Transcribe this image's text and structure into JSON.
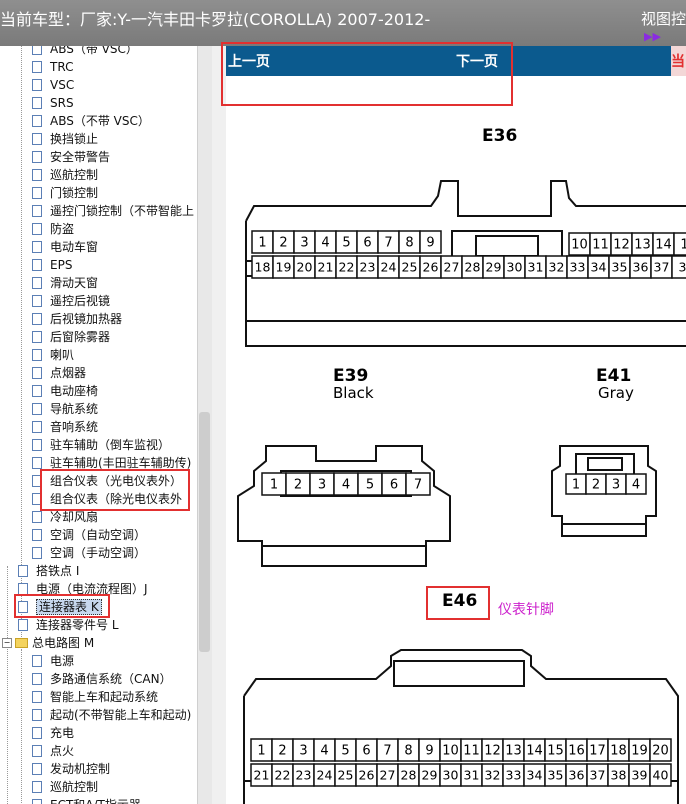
{
  "window": {
    "title": "当前车型：厂家:Y-一汽丰田卡罗拉(COROLLA) 2007-2012-",
    "view_control": "视图控",
    "play_icon": "play-icon"
  },
  "tree": {
    "items": [
      {
        "label": "ABS（带 VSC）",
        "level": 2
      },
      {
        "label": "TRC",
        "level": 2
      },
      {
        "label": "VSC",
        "level": 2
      },
      {
        "label": "SRS",
        "level": 2
      },
      {
        "label": "ABS（不带 VSC）",
        "level": 2
      },
      {
        "label": "换挡锁止",
        "level": 2
      },
      {
        "label": "安全带警告",
        "level": 2
      },
      {
        "label": "巡航控制",
        "level": 2
      },
      {
        "label": "门锁控制",
        "level": 2
      },
      {
        "label": "遥控门锁控制（不带智能上",
        "level": 2
      },
      {
        "label": "防盗",
        "level": 2
      },
      {
        "label": "电动车窗",
        "level": 2
      },
      {
        "label": "EPS",
        "level": 2
      },
      {
        "label": "滑动天窗",
        "level": 2
      },
      {
        "label": "遥控后视镜",
        "level": 2
      },
      {
        "label": "后视镜加热器",
        "level": 2
      },
      {
        "label": "后窗除雾器",
        "level": 2
      },
      {
        "label": "喇叭",
        "level": 2
      },
      {
        "label": "点烟器",
        "level": 2
      },
      {
        "label": "电动座椅",
        "level": 2
      },
      {
        "label": "导航系统",
        "level": 2
      },
      {
        "label": "音响系统",
        "level": 2
      },
      {
        "label": "驻车辅助（倒车监视）",
        "level": 2
      },
      {
        "label": "驻车辅助(丰田驻车辅助传)",
        "level": 2
      },
      {
        "label": "组合仪表（光电仪表外）",
        "level": 2
      },
      {
        "label": "组合仪表（除光电仪表外",
        "level": 2
      },
      {
        "label": "冷却风扇",
        "level": 2
      },
      {
        "label": "空调（自动空调）",
        "level": 2
      },
      {
        "label": "空调（手动空调）",
        "level": 2
      },
      {
        "label": "搭铁点 I",
        "level": 1
      },
      {
        "label": "电源（电流流程图）J",
        "level": 1
      },
      {
        "label": "连接器表 K",
        "level": 1,
        "selected": true
      },
      {
        "label": "连接器零件号 L",
        "level": 1
      },
      {
        "label": "总电路图 M",
        "level": 0,
        "folder": true
      },
      {
        "label": "电源",
        "level": 2
      },
      {
        "label": "多路通信系统（CAN）",
        "level": 2
      },
      {
        "label": "智能上车和起动系统",
        "level": 2
      },
      {
        "label": "起动(不带智能上车和起动)",
        "level": 2
      },
      {
        "label": "充电",
        "level": 2
      },
      {
        "label": "点火",
        "level": 2
      },
      {
        "label": "发动机控制",
        "level": 2
      },
      {
        "label": "巡航控制",
        "level": 2
      },
      {
        "label": "ECT和A/T指示器",
        "level": 2
      }
    ]
  },
  "nav": {
    "prev": "上一页",
    "next": "下一页",
    "right_stub": "当"
  },
  "diagram": {
    "e36": {
      "label": "E36",
      "row1": [
        "1",
        "2",
        "3",
        "4",
        "5",
        "6",
        "7",
        "8",
        "9",
        "10",
        "11",
        "12",
        "13",
        "14",
        "1"
      ],
      "row2": [
        "18",
        "19",
        "20",
        "21",
        "22",
        "23",
        "24",
        "25",
        "26",
        "27",
        "28",
        "29",
        "30",
        "31",
        "32",
        "33",
        "34",
        "35",
        "36",
        "37",
        "3"
      ]
    },
    "e39": {
      "label": "E39",
      "color": "Black",
      "pins": [
        "1",
        "2",
        "3",
        "4",
        "5",
        "6",
        "7"
      ]
    },
    "e41": {
      "label": "E41",
      "color": "Gray",
      "pins": [
        "1",
        "2",
        "3",
        "4"
      ]
    },
    "e46": {
      "label": "E46",
      "note": "仪表针脚",
      "row1": [
        "1",
        "2",
        "3",
        "4",
        "5",
        "6",
        "7",
        "8",
        "9",
        "10",
        "11",
        "12",
        "13",
        "14",
        "15",
        "16",
        "17",
        "18",
        "19",
        "20"
      ],
      "row2": [
        "21",
        "22",
        "23",
        "24",
        "25",
        "26",
        "27",
        "28",
        "29",
        "30",
        "31",
        "32",
        "33",
        "34",
        "35",
        "36",
        "37",
        "38",
        "39",
        "40"
      ]
    }
  },
  "colors": {
    "titlebar": "#888888",
    "navbar": "#0b5a8e",
    "highlight": "#e23030",
    "note": "#cc22cc",
    "selection": "#c7d8ee"
  }
}
